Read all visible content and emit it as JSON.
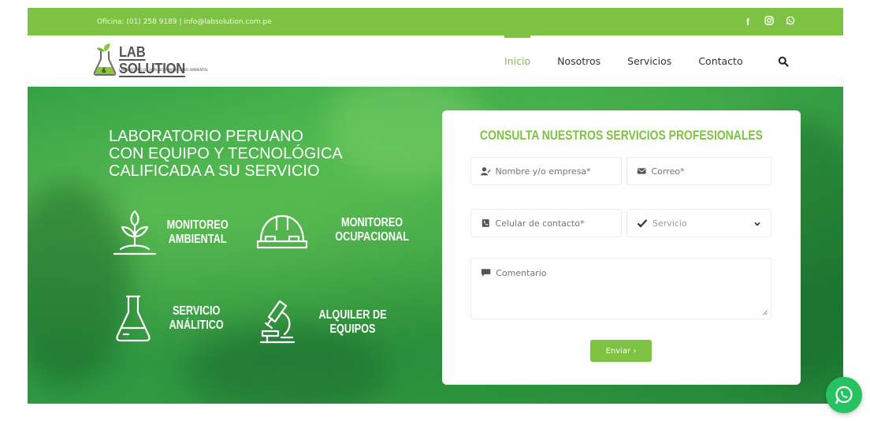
{
  "topbar": {
    "contact": "Oficina: (01) 258 9189  |  info@labsolution.com.pe",
    "social_icons": [
      "facebook-icon",
      "instagram-icon",
      "whatsapp-icon"
    ]
  },
  "logo": {
    "title": "LAB SOLUTION",
    "subtitle": "LABORATORIO DE ANÁLISIS Y MONITOREO AMBIENTAL"
  },
  "nav": {
    "items": [
      {
        "label": "Inicio",
        "active": true
      },
      {
        "label": "Nosotros",
        "active": false
      },
      {
        "label": "Servicios",
        "active": false
      },
      {
        "label": "Contacto",
        "active": false
      }
    ],
    "search_icon": "search-icon"
  },
  "hero": {
    "title_lines": [
      "LABORATORIO PERUANO",
      "CON EQUIPO Y TECNOLÓGICA",
      "CALIFICADA A SU SERVICIO"
    ],
    "services": [
      {
        "line1": "MONITOREO",
        "line2": "AMBIENTAL",
        "icon": "plant-icon"
      },
      {
        "line1": "MONITOREO",
        "line2": "OCUPACIONAL",
        "icon": "hard-hat-icon"
      },
      {
        "line1": "SERVICIO",
        "line2": "ANÁLITICO",
        "icon": "flask-icon"
      },
      {
        "line1": "ALQUILER DE",
        "line2": "EQUIPOS",
        "icon": "microscope-icon"
      }
    ]
  },
  "form": {
    "title": "CONSULTA NUESTROS SERVICIOS PROFESIONALES",
    "name_placeholder": "Nombre y/o empresa*",
    "email_placeholder": "Correo*",
    "phone_placeholder": "Celular de contacto*",
    "service_selected": "Servicio",
    "comment_placeholder": "Comentario",
    "submit_label": "Enviar ›"
  },
  "colors": {
    "brand_green": "#7dc242",
    "hero_green": "#3aa848",
    "whatsapp_green": "#27c262"
  }
}
